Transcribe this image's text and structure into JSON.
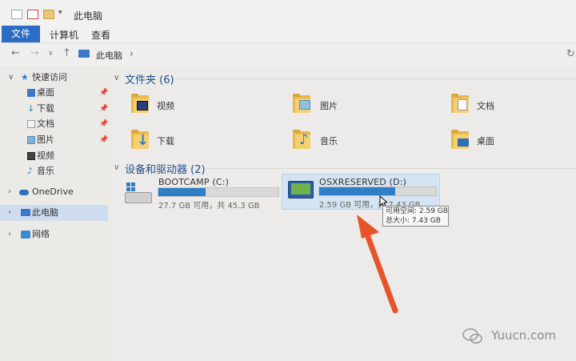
{
  "window": {
    "title": "此电脑"
  },
  "ribbon": {
    "tabs": [
      "文件",
      "计算机",
      "查看"
    ]
  },
  "address": {
    "path": "此电脑",
    "separator": "›"
  },
  "sidebar": {
    "items": [
      {
        "label": "快速访问",
        "icon": "star-icon"
      },
      {
        "label": "桌面",
        "icon": "desktop-icon",
        "pinned": true
      },
      {
        "label": "下载",
        "icon": "download-icon",
        "pinned": true
      },
      {
        "label": "文档",
        "icon": "document-icon",
        "pinned": true
      },
      {
        "label": "图片",
        "icon": "picture-icon",
        "pinned": true
      },
      {
        "label": "视频",
        "icon": "video-icon"
      },
      {
        "label": "音乐",
        "icon": "music-icon"
      },
      {
        "label": "OneDrive",
        "icon": "cloud-icon"
      },
      {
        "label": "此电脑",
        "icon": "computer-icon",
        "selected": true
      },
      {
        "label": "网络",
        "icon": "network-icon"
      }
    ]
  },
  "folders": {
    "header": "文件夹 (6)",
    "items": [
      {
        "label": "视频",
        "icon": "video-folder-icon"
      },
      {
        "label": "图片",
        "icon": "pictures-folder-icon"
      },
      {
        "label": "文档",
        "icon": "documents-folder-icon"
      },
      {
        "label": "下载",
        "icon": "downloads-folder-icon"
      },
      {
        "label": "音乐",
        "icon": "music-folder-icon"
      },
      {
        "label": "桌面",
        "icon": "desktop-folder-icon"
      }
    ]
  },
  "devices": {
    "header": "设备和驱动器 (2)",
    "drives": [
      {
        "name": "BOOTCAMP (C:)",
        "free_text": "27.7 GB 可用，共 45.3 GB",
        "used_fraction": 0.39
      },
      {
        "name": "OSXRESERVED (D:)",
        "free_text": "2.59 GB 可用，共 7.43 GB",
        "used_fraction": 0.65,
        "selected": true
      }
    ]
  },
  "tooltip": {
    "line1": "可用空间: 2.59 GB",
    "line2": "总大小: 7.43 GB"
  },
  "watermark": {
    "text": "Yuucn.com"
  },
  "colors": {
    "accent": "#2b6cc4",
    "drive_fill": "#2f7fc8",
    "arrow": "#e8542a",
    "folder": "#e8b94a"
  }
}
